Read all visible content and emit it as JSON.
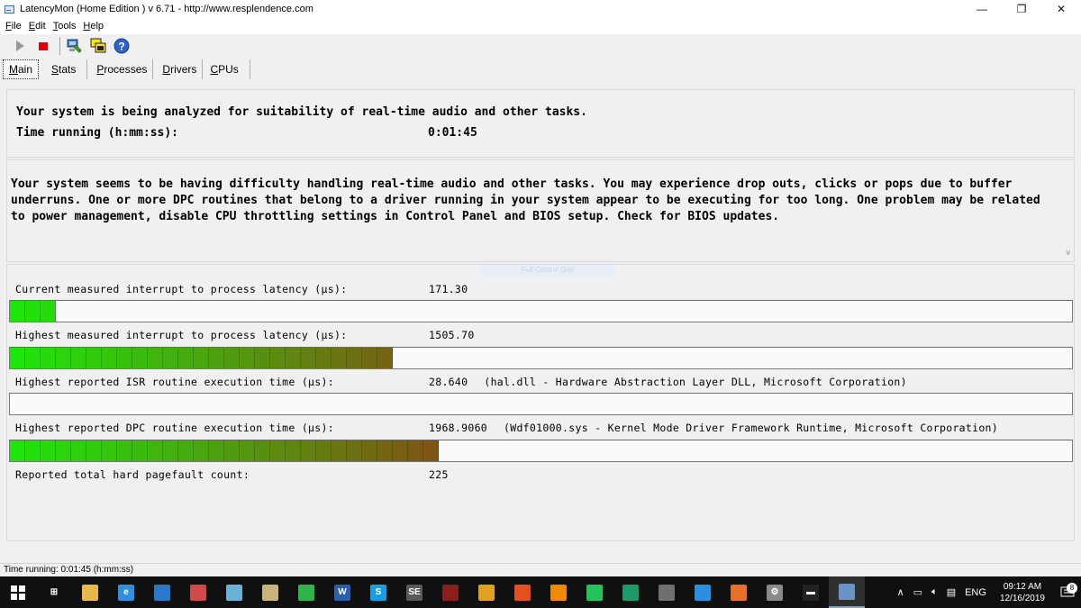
{
  "window": {
    "title": "LatencyMon  (Home Edition )  v 6.71 - http://www.resplendence.com",
    "minimize": "—",
    "restore": "❐",
    "close": "✕"
  },
  "menu": [
    {
      "mn": "F",
      "rest": "ile"
    },
    {
      "mn": "E",
      "rest": "dit"
    },
    {
      "mn": "T",
      "rest": "ools"
    },
    {
      "mn": "H",
      "rest": "elp"
    }
  ],
  "toolbar": {
    "icons": [
      "play-icon",
      "stop-icon",
      "computer-icon",
      "windows-icon",
      "help-icon"
    ],
    "help_glyph": "?"
  },
  "tabs": [
    {
      "mn": "M",
      "rest": "ain",
      "active": true
    },
    {
      "mn": "S",
      "rest": "tats",
      "active": false
    },
    {
      "mn": "P",
      "rest": "rocesses",
      "active": false
    },
    {
      "mn": "D",
      "rest": "rivers",
      "active": false
    },
    {
      "mn": "C",
      "rest": "PUs",
      "active": false
    }
  ],
  "analysis": {
    "status_line": "Your system is being analyzed for suitability of real-time audio and other tasks.",
    "time_label": "Time running (h:mm:ss):",
    "time_value": "0:01:45"
  },
  "message": {
    "text": "Your system seems to be having difficulty handling real-time audio and other tasks. You may experience drop outs, clicks or pops due to buffer underruns. One or more DPC routines that belong to a driver running in your system appear to be executing for too long. One problem may be related to power management, disable CPU throttling settings in Control Panel and BIOS setup. Check for BIOS updates."
  },
  "stats": {
    "ghost_button": "Full Control Grid",
    "rows": [
      {
        "label": "Current measured interrupt to process latency (µs):",
        "value": "171.30",
        "extra": "",
        "bar_segments": 3
      },
      {
        "label": "Highest measured interrupt to process latency (µs):",
        "value": "1505.70",
        "extra": "",
        "bar_segments": 25
      },
      {
        "label": "Highest reported ISR routine execution time (µs):",
        "value": "28.640",
        "extra": "(hal.dll - Hardware Abstraction Layer DLL, Microsoft Corporation)",
        "bar_segments": 0
      },
      {
        "label": "Highest reported DPC routine execution time (µs):",
        "value": "1968.9060",
        "extra": "(Wdf01000.sys - Kernel Mode Driver Framework Runtime, Microsoft Corporation)",
        "bar_segments": 28
      },
      {
        "label": "Reported total hard pagefault count:",
        "value": "225",
        "extra": "",
        "bar_segments": null
      }
    ]
  },
  "statusbar": {
    "text": "Time running: 0:01:45  (h:mm:ss)"
  },
  "taskbar": {
    "apps": [
      {
        "name": "task-view-icon",
        "color": "#101010",
        "glyph": "⊞"
      },
      {
        "name": "file-explorer-icon",
        "color": "#e8b84a",
        "glyph": ""
      },
      {
        "name": "edge-icon",
        "color": "#2f8fdc",
        "glyph": "e"
      },
      {
        "name": "photos-icon",
        "color": "#2b78c9",
        "glyph": ""
      },
      {
        "name": "paint-icon",
        "color": "#d04a4a",
        "glyph": ""
      },
      {
        "name": "notes-icon",
        "color": "#6bb3d6",
        "glyph": ""
      },
      {
        "name": "hdd-icon",
        "color": "#c8b47a",
        "glyph": ""
      },
      {
        "name": "whatsapp-desktop-icon",
        "color": "#2fb34a",
        "glyph": ""
      },
      {
        "name": "word-icon",
        "color": "#2b5fa8",
        "glyph": "W"
      },
      {
        "name": "skype-icon",
        "color": "#1a9ee0",
        "glyph": "S"
      },
      {
        "name": "se-icon",
        "color": "#5a5a5a",
        "glyph": "SE"
      },
      {
        "name": "media-icon",
        "color": "#8a1f1f",
        "glyph": ""
      },
      {
        "name": "chrome-icon",
        "color": "#e0a020",
        "glyph": ""
      },
      {
        "name": "brave-icon",
        "color": "#e25020",
        "glyph": ""
      },
      {
        "name": "vlc-icon",
        "color": "#f08a00",
        "glyph": ""
      },
      {
        "name": "whatsapp-icon",
        "color": "#24c35a",
        "glyph": ""
      },
      {
        "name": "kaspersky-icon",
        "color": "#1e9a6a",
        "glyph": ""
      },
      {
        "name": "film-icon",
        "color": "#707070",
        "glyph": ""
      },
      {
        "name": "windows-store-icon",
        "color": "#2a8fe0",
        "glyph": ""
      },
      {
        "name": "firefox-icon",
        "color": "#e8702a",
        "glyph": ""
      },
      {
        "name": "settings-icon",
        "color": "#8a8a8a",
        "glyph": "⚙"
      },
      {
        "name": "terminal-icon",
        "color": "#222222",
        "glyph": "▬"
      },
      {
        "name": "latencymon-taskbar-icon",
        "color": "#6b93c7",
        "glyph": ""
      }
    ],
    "tray": {
      "chevron": "∧",
      "lang": "ENG",
      "time": "09:12 AM",
      "date": "12/16/2019",
      "notifications": "8"
    }
  }
}
